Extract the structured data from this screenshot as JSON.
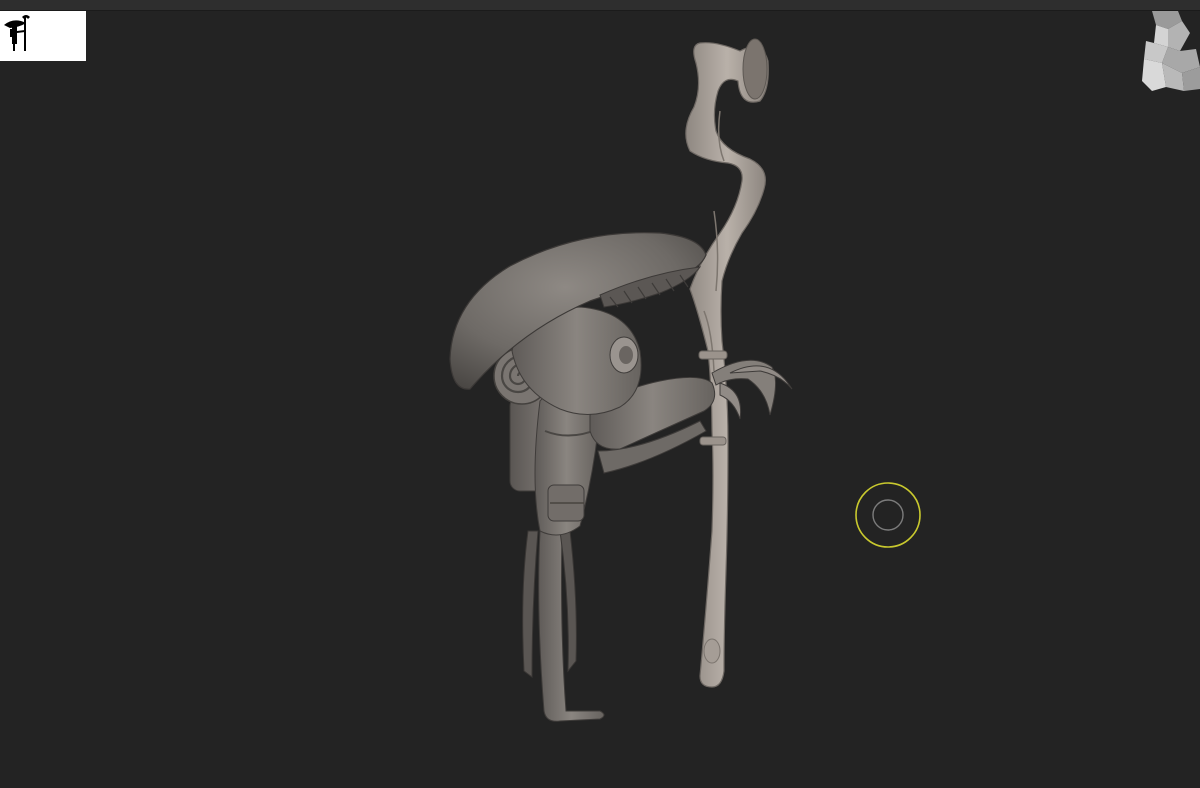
{
  "colors": {
    "viewport_background": "#232323",
    "model_matcap": "#8a8580",
    "brush_cursor": "#c9c92e",
    "silhouette_background": "#ffffff",
    "silhouette_fill": "#000000"
  },
  "viewport": {
    "silhouette_thumbnail_icon": "mushroom-character-silhouette-icon",
    "navigation_cube_icon": "navigation-cube-icon",
    "model_icon": "mushroom-wanderer-with-staff",
    "brush_cursor_icon": "brush-cursor-icon"
  }
}
